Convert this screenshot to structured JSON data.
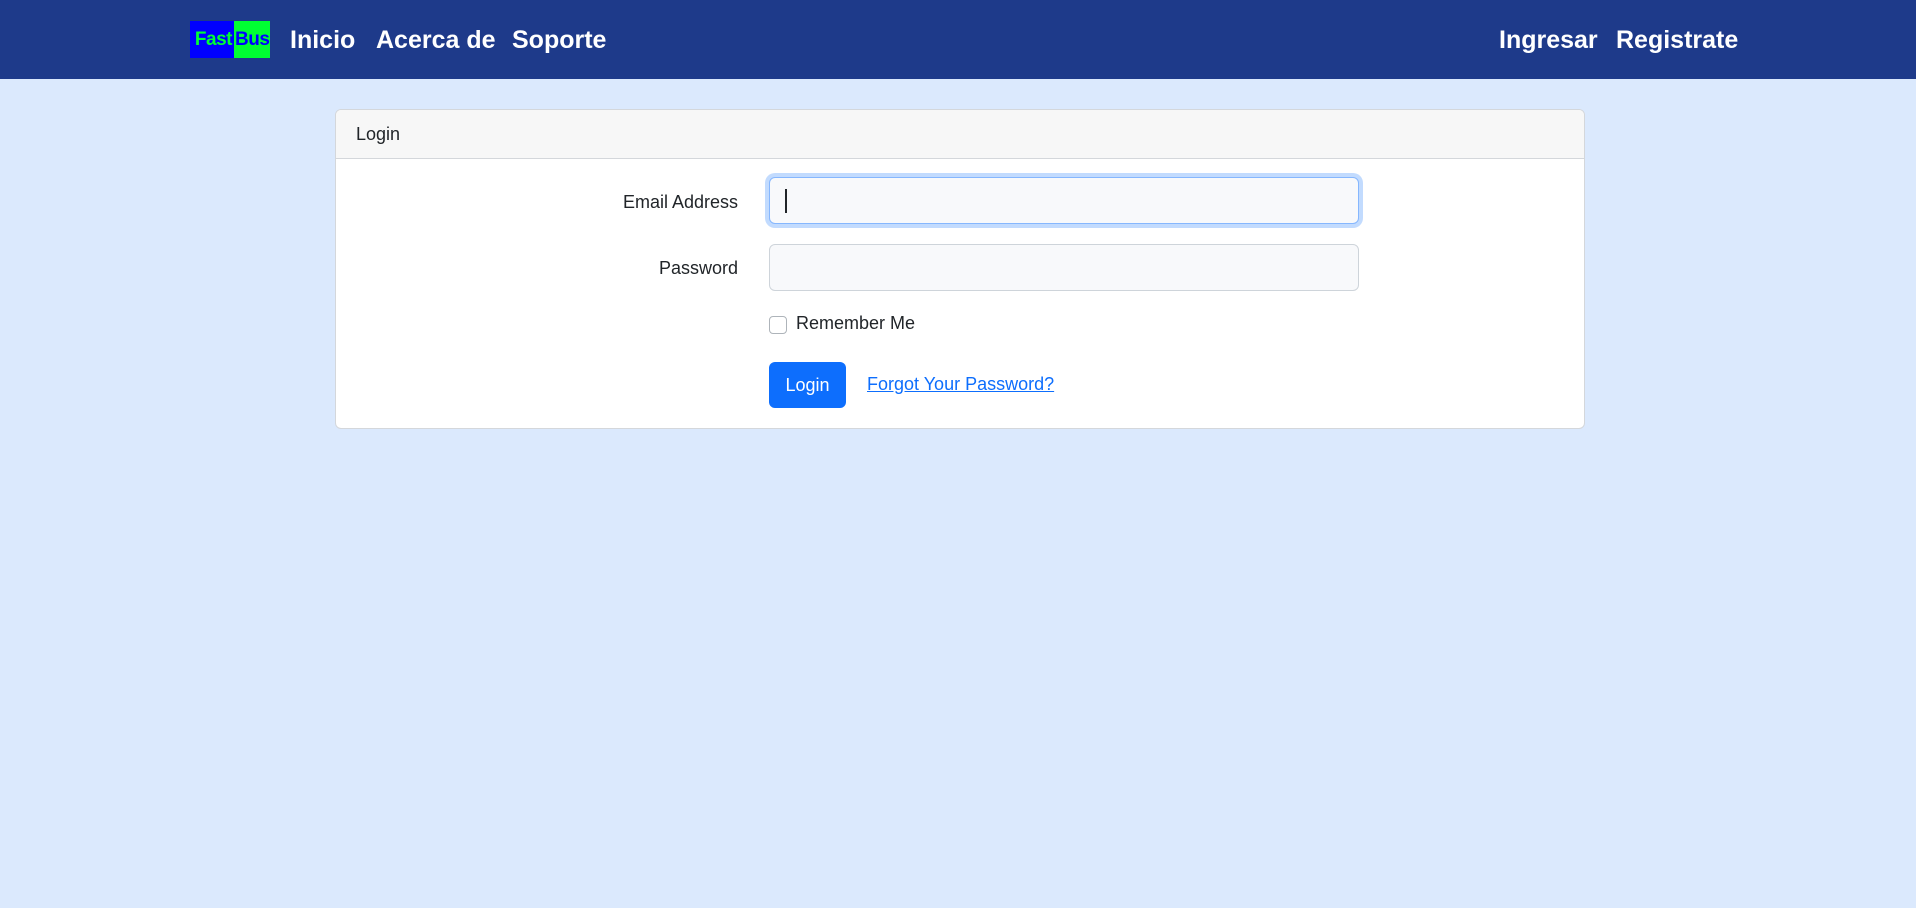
{
  "navbar": {
    "logo": {
      "part1": "Fast",
      "part2": "Bus"
    },
    "links": [
      "Inicio",
      "Acerca de",
      "Soporte"
    ],
    "right_links": [
      "Ingresar",
      "Registrate"
    ],
    "colors": {
      "background": "#1e3a8a",
      "text": "#ffffff"
    }
  },
  "login_card": {
    "header": "Login",
    "email": {
      "label": "Email Address",
      "value": ""
    },
    "password": {
      "label": "Password",
      "value": ""
    },
    "remember": {
      "label": "Remember Me",
      "checked": false
    },
    "submit_label": "Login",
    "forgot_label": "Forgot Your Password?",
    "colors": {
      "primary": "#0d6efd",
      "page_background": "#dbe9fd"
    }
  }
}
